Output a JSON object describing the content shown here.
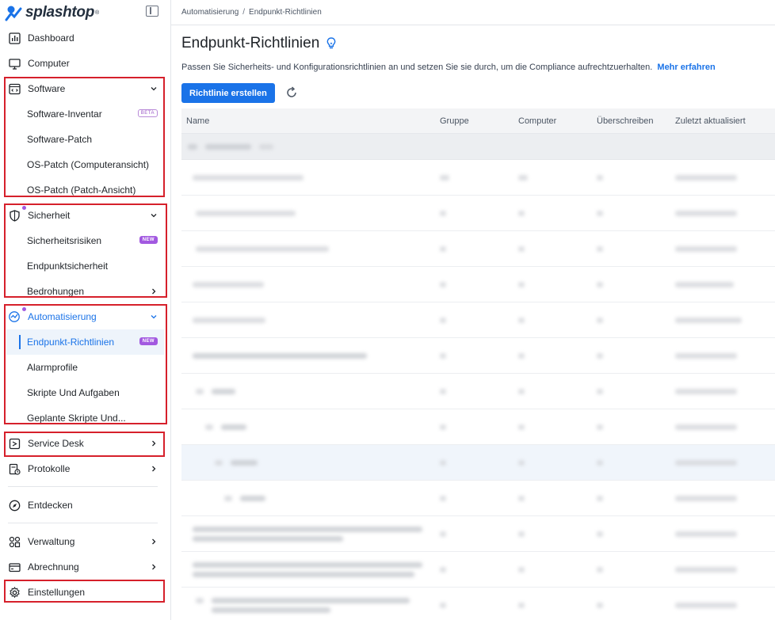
{
  "brand": {
    "name": "splashtop",
    "reg": "®"
  },
  "breadcrumb": {
    "parent": "Automatisierung",
    "separator": "/",
    "current": "Endpunkt-Richtlinien"
  },
  "sidebar": {
    "dashboard": "Dashboard",
    "computer": "Computer",
    "software": {
      "label": "Software",
      "items": [
        "Software-Inventar",
        "Software-Patch",
        "OS-Patch (Computeransicht)",
        "OS-Patch (Patch-Ansicht)"
      ],
      "beta": "BETA"
    },
    "security": {
      "label": "Sicherheit",
      "items": [
        "Sicherheitsrisiken",
        "Endpunktsicherheit",
        "Bedrohungen"
      ],
      "new": "NEW"
    },
    "automation": {
      "label": "Automatisierung",
      "items": [
        "Endpunkt-Richtlinien",
        "Alarmprofile",
        "Skripte Und Aufgaben",
        "Geplante Skripte Und..."
      ],
      "new": "NEW"
    },
    "service_desk": "Service Desk",
    "logs": "Protokolle",
    "discover": "Entdecken",
    "admin": "Verwaltung",
    "billing": "Abrechnung",
    "settings": "Einstellungen"
  },
  "page": {
    "title": "Endpunkt-Richtlinien",
    "subtitle": "Passen Sie Sicherheits- und Konfigurationsrichtlinien an und setzen Sie sie durch, um die Compliance aufrechtzuerhalten.",
    "more_link": "Mehr erfahren",
    "create_button": "Richtlinie erstellen"
  },
  "table": {
    "columns": [
      "Name",
      "Gruppe",
      "Computer",
      "Überschreiben",
      "Zuletzt aktualisiert"
    ]
  },
  "colors": {
    "accent": "#1a73e8",
    "highlight": "#d6202b",
    "badge": "#a259e0"
  }
}
